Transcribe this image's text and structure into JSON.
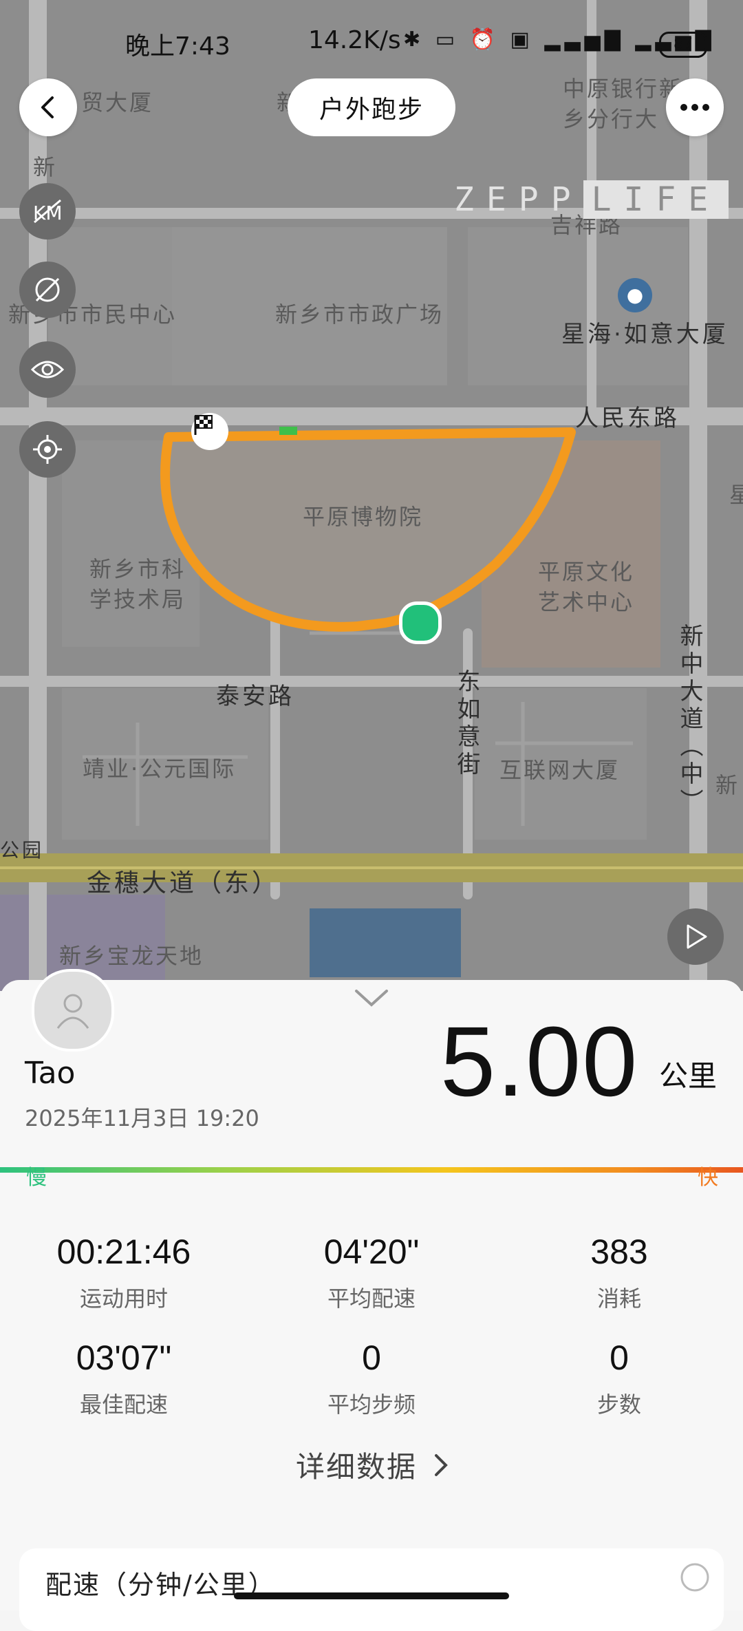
{
  "status_bar": {
    "time": "晚上7:43",
    "network_speed": "14.2K/s",
    "icons": [
      "bluetooth-icon",
      "vibrate-icon",
      "alarm-icon",
      "hd-icon",
      "signal-4g-icon",
      "signal-5g-icon"
    ],
    "battery": "87"
  },
  "header": {
    "title": "户外跑步"
  },
  "watermark": {
    "left": "ZEPP",
    "right": "LIFE"
  },
  "map_labels": {
    "l1": "贸大厦",
    "l2": "新",
    "l3": "中原银行新",
    "l4": "乡分行大",
    "l5": "新",
    "l6": "吉祥路",
    "l7": "新乡市市民中心",
    "l8": "新乡市市政广场",
    "l9": "星海·如意大厦",
    "l10": "人民东路",
    "l11": "平原博物院",
    "l12": "新乡市科",
    "l13": "学技术局",
    "l14": "平原文化",
    "l15": "艺术中心",
    "l16": "泰安路",
    "l17": "东如意街",
    "l18": "新中大道（中）",
    "l19": "靖业·公元国际",
    "l20": "互联网大厦",
    "l21": "公园",
    "l22": "金穗大道（东）",
    "l23": "新乡宝龙天地",
    "l24": "新",
    "l25": "星"
  },
  "summary": {
    "username": "Tao",
    "datetime": "2025年11月3日 19:20",
    "distance": "5.00",
    "unit": "公里",
    "slow_label": "慢",
    "fast_label": "快"
  },
  "stats": [
    {
      "value": "00:21:46",
      "label": "运动用时"
    },
    {
      "value": "04'20\"",
      "label": "平均配速"
    },
    {
      "value": "383",
      "label": "消耗"
    },
    {
      "value": "03'07\"",
      "label": "最佳配速"
    },
    {
      "value": "0",
      "label": "平均步频"
    },
    {
      "value": "0",
      "label": "步数"
    }
  ],
  "detail_link": "详细数据",
  "pace_card_title": "配速（分钟/公里）",
  "colors": {
    "route": "#f39a1e",
    "start_dot": "#21c07a",
    "pace_slow": "#2ec27e",
    "pace_fast": "#e8571f"
  }
}
